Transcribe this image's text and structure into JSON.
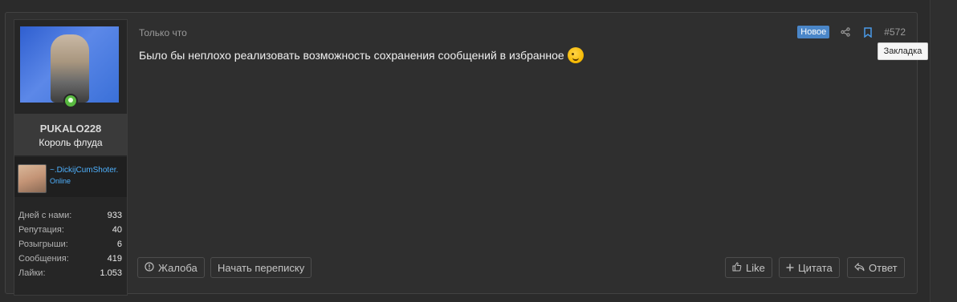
{
  "user": {
    "username": "PUKALO228",
    "title": "Король флуда",
    "referral": {
      "name": "~.DickijCumShoter.",
      "status": "Online"
    },
    "stats": [
      {
        "label": "Дней с нами:",
        "value": "933"
      },
      {
        "label": "Репутация:",
        "value": "40"
      },
      {
        "label": "Розыгрыши:",
        "value": "6"
      },
      {
        "label": "Сообщения:",
        "value": "419"
      },
      {
        "label": "Лайки:",
        "value": "1.053"
      }
    ]
  },
  "post": {
    "time": "Только что",
    "badge": "Новое",
    "number": "#572",
    "message": "Было бы неплохо реализовать возможность сохранения сообщений в избранное",
    "tooltip": "Закладка"
  },
  "actions": {
    "report": "Жалоба",
    "start_conversation": "Начать переписку",
    "like": "Like",
    "quote": "Цитата",
    "reply": "Ответ"
  },
  "icons": {
    "share": "share-icon",
    "bookmark": "bookmark-icon",
    "warning": "warning-icon",
    "like": "thumbs-up-icon",
    "quote": "plus-icon",
    "reply": "reply-icon"
  }
}
